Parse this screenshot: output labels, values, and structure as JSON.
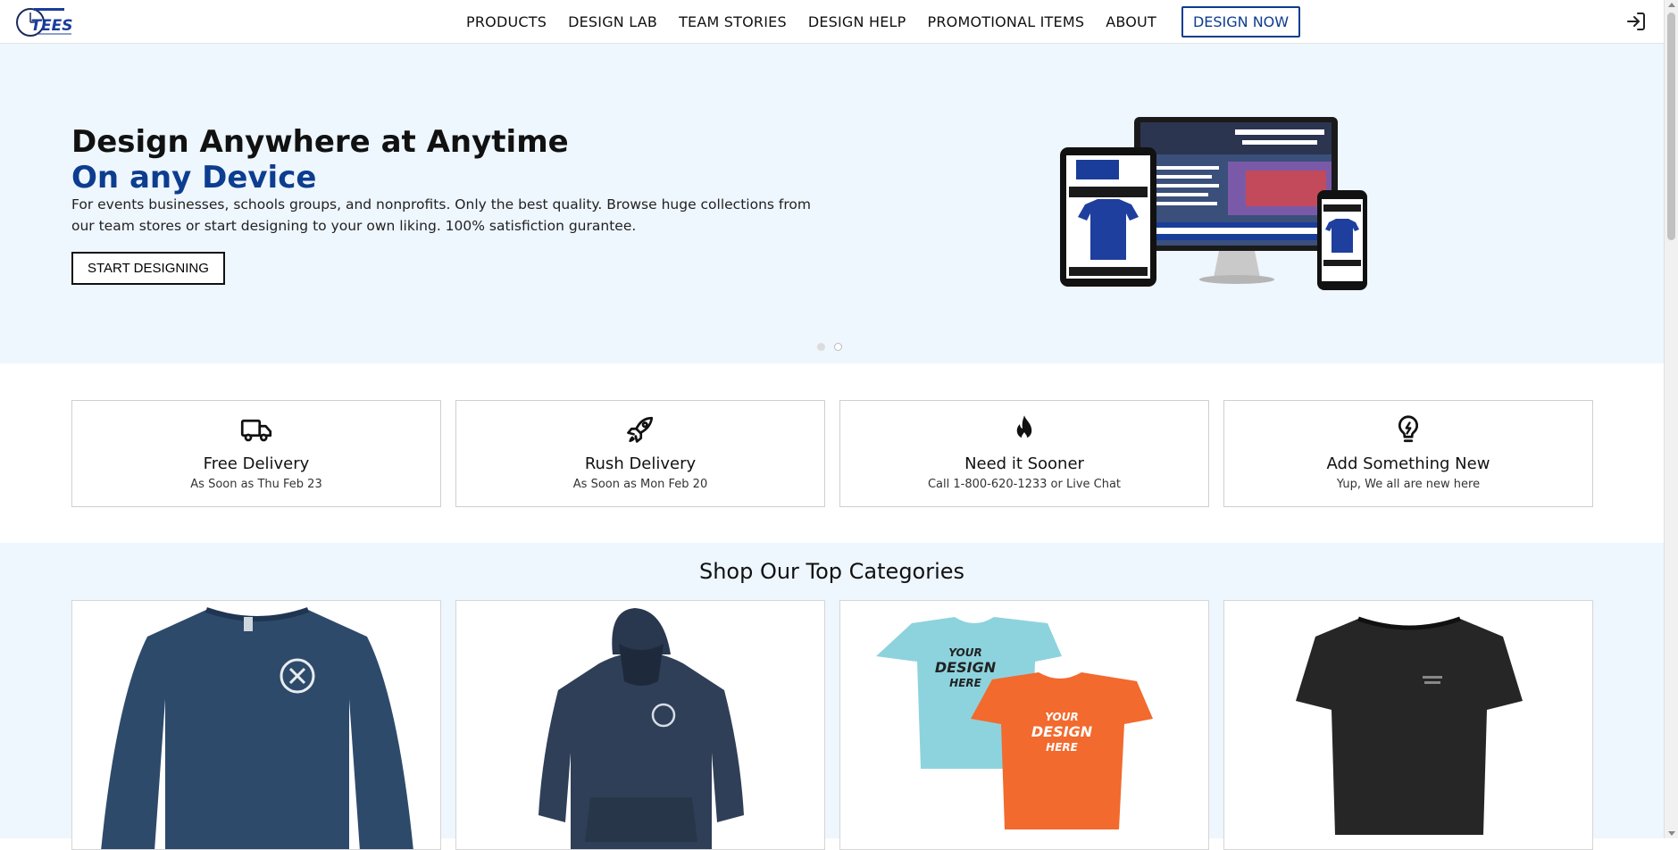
{
  "header": {
    "logo_alt": "Around The Clock TEES logo",
    "nav": [
      "PRODUCTS",
      "DESIGN LAB",
      "TEAM STORIES",
      "DESIGN HELP",
      "PROMOTIONAL ITEMS",
      "ABOUT"
    ],
    "cta": "DESIGN NOW",
    "login_icon": "login-icon"
  },
  "hero": {
    "title": "Design Anywhere at Anytime",
    "subtitle": "On any Device",
    "description": "For events businesses, schools groups, and nonprofits. Only the best quality. Browse huge collections from our team stores or start designing to your own liking. 100% satisfiction gurantee.",
    "button": "START DESIGNING",
    "slides": 2,
    "active_slide": 2
  },
  "features": [
    {
      "icon": "truck-icon",
      "title": "Free Delivery",
      "text": "As Soon as Thu Feb 23"
    },
    {
      "icon": "rocket-icon",
      "title": "Rush Delivery",
      "text": "As Soon as Mon Feb 20"
    },
    {
      "icon": "flame-icon",
      "title": "Need it Sooner",
      "text": "Call 1-800-620-1233 or Live Chat"
    },
    {
      "icon": "lightbulb-icon",
      "title": "Add Something New",
      "text": "Yup, We all are new here"
    }
  ],
  "categories": {
    "title": "Shop Our Top Categories",
    "items": [
      {
        "image": "long-sleeve-shirt-image"
      },
      {
        "image": "hoodie-image"
      },
      {
        "image": "design-tees-image"
      },
      {
        "image": "black-tshirt-image"
      }
    ]
  },
  "colors": {
    "brand": "#0d3d8f",
    "hero_bg": "#eef6fe",
    "text": "#111111"
  }
}
